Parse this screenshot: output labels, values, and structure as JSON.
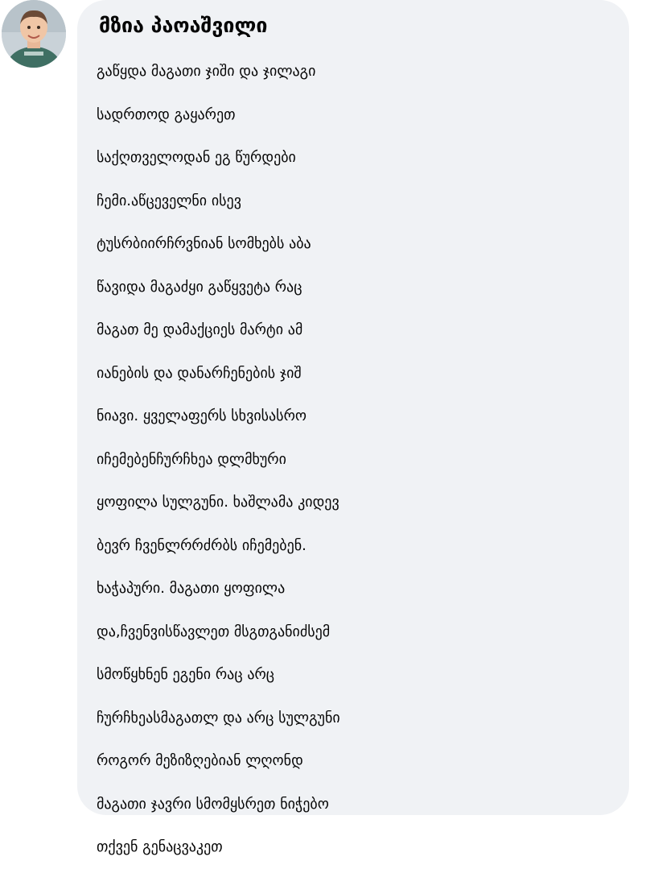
{
  "comment": {
    "avatar_icon": "user-avatar",
    "author": "მზია პაოაშვილი",
    "lines": [
      "გაწყდა მაგათი ჯიში და ჯილაგი",
      "სადრთოდ გაყარეთ",
      "საქღთველოდან ეგ წურდები",
      "ჩემი.აწცეველნი ისევ",
      "ტუსრბიირჩრვნიან სომხებს აბა",
      "წავიდა მაგაძყი გაწყვეტა რაც",
      "მაგათ მე დამაქციეს მარტი ამ",
      "იანების და დანარჩენების ჯიშ",
      "ნიავი. ყველაფერს სხვისასრო",
      "იჩემებენჩურჩხეა დლმხური",
      "ყოფილა სულგუნი. ხაშლამა კიდევ",
      "ბევრ ჩვენლრრძრბს იჩემებენ.",
      "ხაჭაპური. მაგათი ყოფილა",
      "და,ჩვენვისწავლეთ მსგთგანიძსემ",
      "სმოწყხნენ ეგენი რაც არც",
      "ჩურჩხეასმაგათლ და არც სულგუნი",
      "როგორ მეზიზღებიან ლღონდ",
      "მაგათი ჯავრი სმომყსრეთ ნიჭებო",
      "თქვენ გენაცვაკეთ"
    ]
  }
}
